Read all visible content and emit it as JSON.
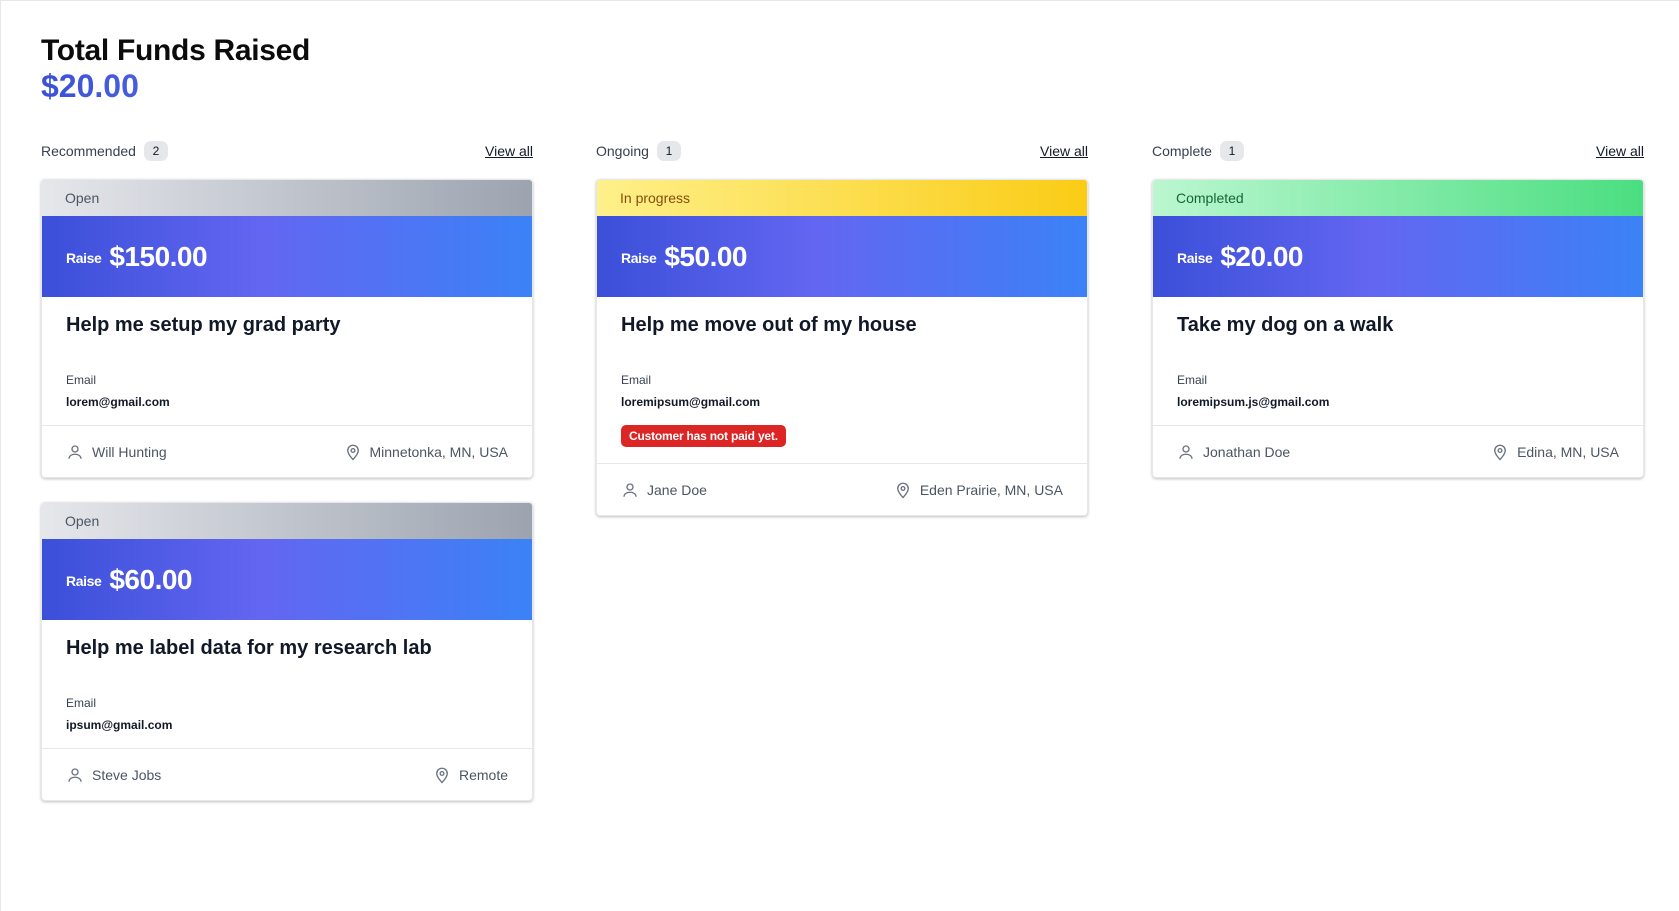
{
  "header": {
    "title": "Total Funds Raised",
    "total": "$20.00"
  },
  "view_all_label": "View all",
  "raise_label": "Raise",
  "email_label": "Email",
  "columns": [
    {
      "title": "Recommended",
      "count": "2",
      "cards": [
        {
          "status": "Open",
          "amount": "$150.00",
          "title": "Help me setup my grad party",
          "email": "lorem@gmail.com",
          "person": "Will Hunting",
          "location": "Minnetonka, MN, USA"
        },
        {
          "status": "Open",
          "amount": "$60.00",
          "title": "Help me label data for my research lab",
          "email": "ipsum@gmail.com",
          "person": "Steve Jobs",
          "location": "Remote"
        }
      ]
    },
    {
      "title": "Ongoing",
      "count": "1",
      "cards": [
        {
          "status": "In progress",
          "amount": "$50.00",
          "title": "Help me move out of my house",
          "email": "loremipsum@gmail.com",
          "alert": "Customer has not paid yet.",
          "person": "Jane Doe",
          "location": "Eden Prairie, MN, USA"
        }
      ]
    },
    {
      "title": "Complete",
      "count": "1",
      "cards": [
        {
          "status": "Completed",
          "amount": "$20.00",
          "title": "Take my dog on a walk",
          "email": "loremipsum.js@gmail.com",
          "person": "Jonathan Doe",
          "location": "Edina, MN, USA"
        }
      ]
    }
  ]
}
